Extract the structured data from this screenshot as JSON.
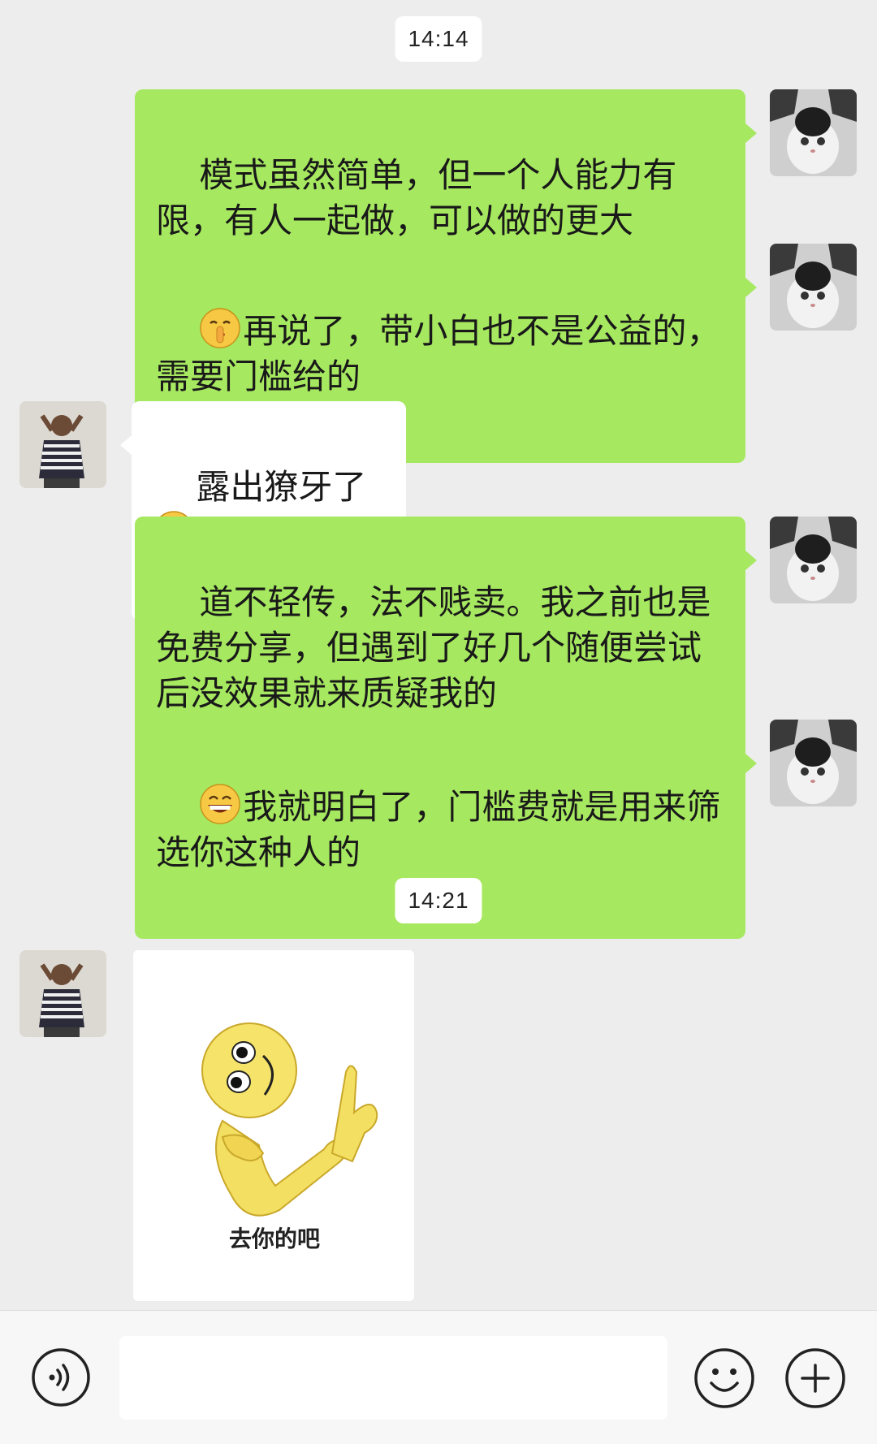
{
  "conversation": {
    "timestamps": [
      "14:14",
      "14:21"
    ],
    "messages": [
      {
        "sender": "me",
        "text": "模式虽然简单，但一个人能力有限，有人一起做，可以做的更大"
      },
      {
        "sender": "me",
        "emoji": "shushing-face",
        "text": "再说了，带小白也不是公益的，需要门槛给的"
      },
      {
        "sender": "other",
        "text": "露出獠牙了",
        "emoji": "tears-of-joy"
      },
      {
        "sender": "me",
        "text": "道不轻传，法不贱卖。我之前也是免费分享，但遇到了好几个随便尝试后没效果就来质疑我的"
      },
      {
        "sender": "me",
        "emoji": "grinning-face",
        "text": "我就明白了，门槛费就是用来筛选你这种人的"
      },
      {
        "sender": "other",
        "sticker": "pointing-smiley-sticker",
        "caption": "去你的吧"
      }
    ]
  },
  "input_bar": {
    "voice_icon": "voice-icon",
    "input_placeholder": "",
    "emoji_icon": "emoji-icon",
    "more_icon": "plus-icon"
  },
  "colors": {
    "sent_bubble": "#a6e860",
    "recv_bubble": "#ffffff",
    "background": "#ededed"
  }
}
